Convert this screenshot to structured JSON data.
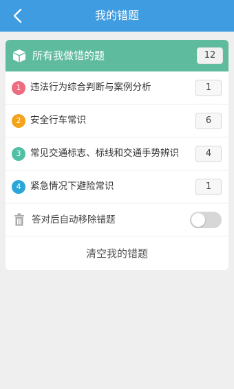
{
  "topbar": {
    "title": "我的错题",
    "back_icon": "chevron-left-icon",
    "color": "#3f9ce0"
  },
  "header": {
    "label": "所有我做错的题",
    "count": "12",
    "icon": "box-icon",
    "color": "#5fbb9e"
  },
  "categories": [
    {
      "num": "1",
      "label": "违法行为综合判断与案例分析",
      "count": "1",
      "color": "#ef6b7f"
    },
    {
      "num": "2",
      "label": "安全行车常识",
      "count": "6",
      "color": "#f5a21b"
    },
    {
      "num": "3",
      "label": "常见交通标志、标线和交通手势辨识",
      "count": "4",
      "color": "#4fbfa5"
    },
    {
      "num": "4",
      "label": "紧急情况下避险常识",
      "count": "1",
      "color": "#2aa7d8"
    }
  ],
  "auto_remove": {
    "label": "答对后自动移除错题",
    "enabled": false,
    "icon": "trash-icon"
  },
  "clear_button": {
    "label": "清空我的错题"
  }
}
